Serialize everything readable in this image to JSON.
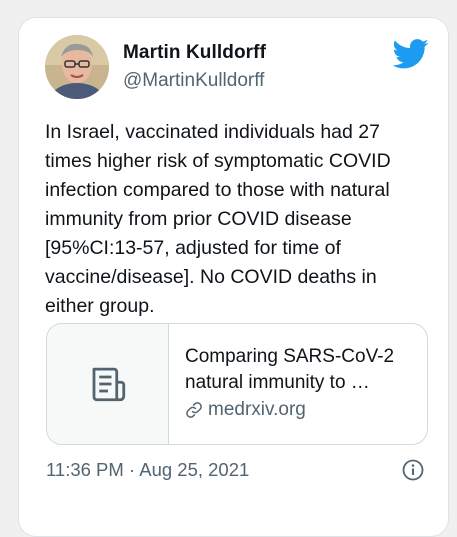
{
  "author": {
    "name": "Martin Kulldorff",
    "handle": "@MartinKulldorff"
  },
  "tweet": {
    "text": "In Israel, vaccinated individuals had 27\ntimes higher risk of symptomatic COVID\ninfection compared to those with natural\nimmunity from prior COVID disease\n[95%CI:13-57, adjusted for time of\nvaccine/disease]. No COVID deaths in\neither group."
  },
  "link_card": {
    "title": "Comparing SARS-CoV-2\nnatural immunity to …",
    "domain": "medrxiv.org",
    "thumbnail_icon": "document-icon"
  },
  "timestamp": "11:36 PM · Aug 25, 2021",
  "icons": {
    "brand": "twitter-bird-icon",
    "info": "info-icon",
    "link": "link-icon"
  },
  "colors": {
    "brand": "#1d9bf0",
    "text": "#0f1419",
    "secondary": "#536471",
    "border": "#cfd9de"
  }
}
